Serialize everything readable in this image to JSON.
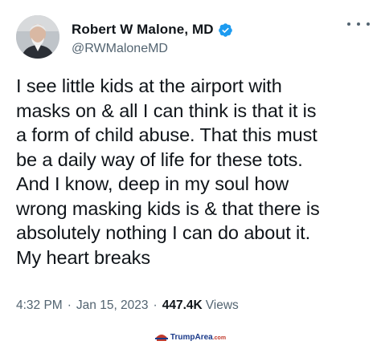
{
  "tweet": {
    "author": {
      "display_name": "Robert W Malone, MD",
      "handle": "@RWMaloneMD",
      "verified": true,
      "avatar": "profile-photo",
      "verified_icon": "verified-badge-icon",
      "more_icon": "more-options-icon"
    },
    "text_lines": [
      "I see little kids at the airport with",
      "masks on & all I can think is that it is",
      "a form of child abuse. That this must",
      "be a daily way of life for these tots.",
      "And I know, deep in my soul how",
      "wrong masking kids is & that there is",
      "absolutely nothing I can do about it.",
      "My heart breaks"
    ],
    "meta": {
      "time": "4:32 PM",
      "separator": "·",
      "date": "Jan 15, 2023",
      "views_count": "447.4K",
      "views_label": "Views"
    }
  },
  "watermark": {
    "brand": "TrumpArea",
    "suffix": ".com",
    "logo_icon": "trump-area-logo-icon"
  },
  "colors": {
    "text_primary": "#0f1419",
    "text_secondary": "#536471",
    "verified_blue": "#1d9bf0",
    "background": "#ffffff"
  }
}
